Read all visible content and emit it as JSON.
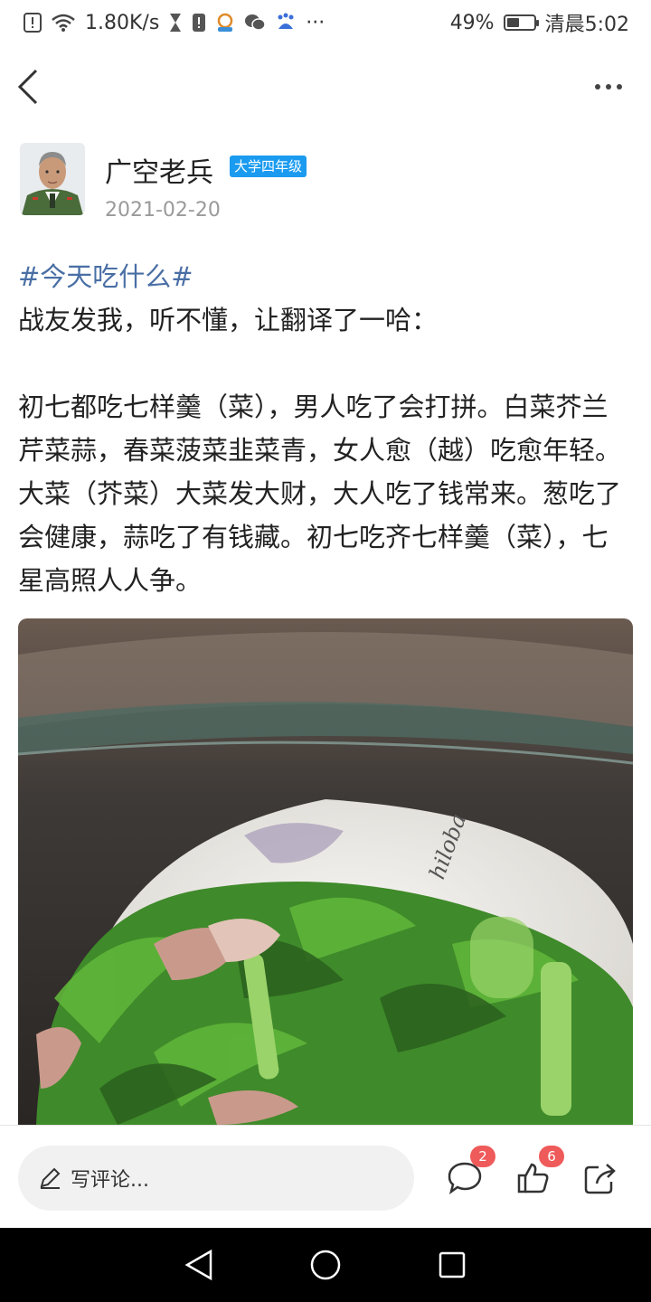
{
  "status_bar": {
    "net_speed": "1.80K/s",
    "battery_percent": "49%",
    "battery_level": 0.49,
    "time": "清晨5:02",
    "more_glyph": "···"
  },
  "navbar": {
    "back_icon": "chevron-left-icon",
    "more_icon": "more-dots-icon"
  },
  "author": {
    "name": "广空老兵",
    "level": "大学四年级",
    "date": "2021-02-20"
  },
  "post": {
    "hashtag": "#今天吃什么#",
    "intro": "战友发我，听不懂，让翻译了一哈：",
    "body": "初七都吃七样羹（菜），男人吃了会打拼。白菜芥兰芹菜蒜，春菜菠菜韭菜青，女人愈（越）吃愈年轻。大菜（芥菜）大菜发大财，大人吃了钱常来。葱吃了会健康，蒜吃了有钱藏。初七吃齐七样羹（菜），七星高照人人争。",
    "image_watermark": "hiloba"
  },
  "actionbar": {
    "comment_placeholder": "写评论...",
    "comment_count": "2",
    "like_count": "6"
  },
  "colors": {
    "hashtag": "#4a6fa5",
    "level_badge": "#1a9bf0",
    "count_badge": "#ef5a5a"
  }
}
